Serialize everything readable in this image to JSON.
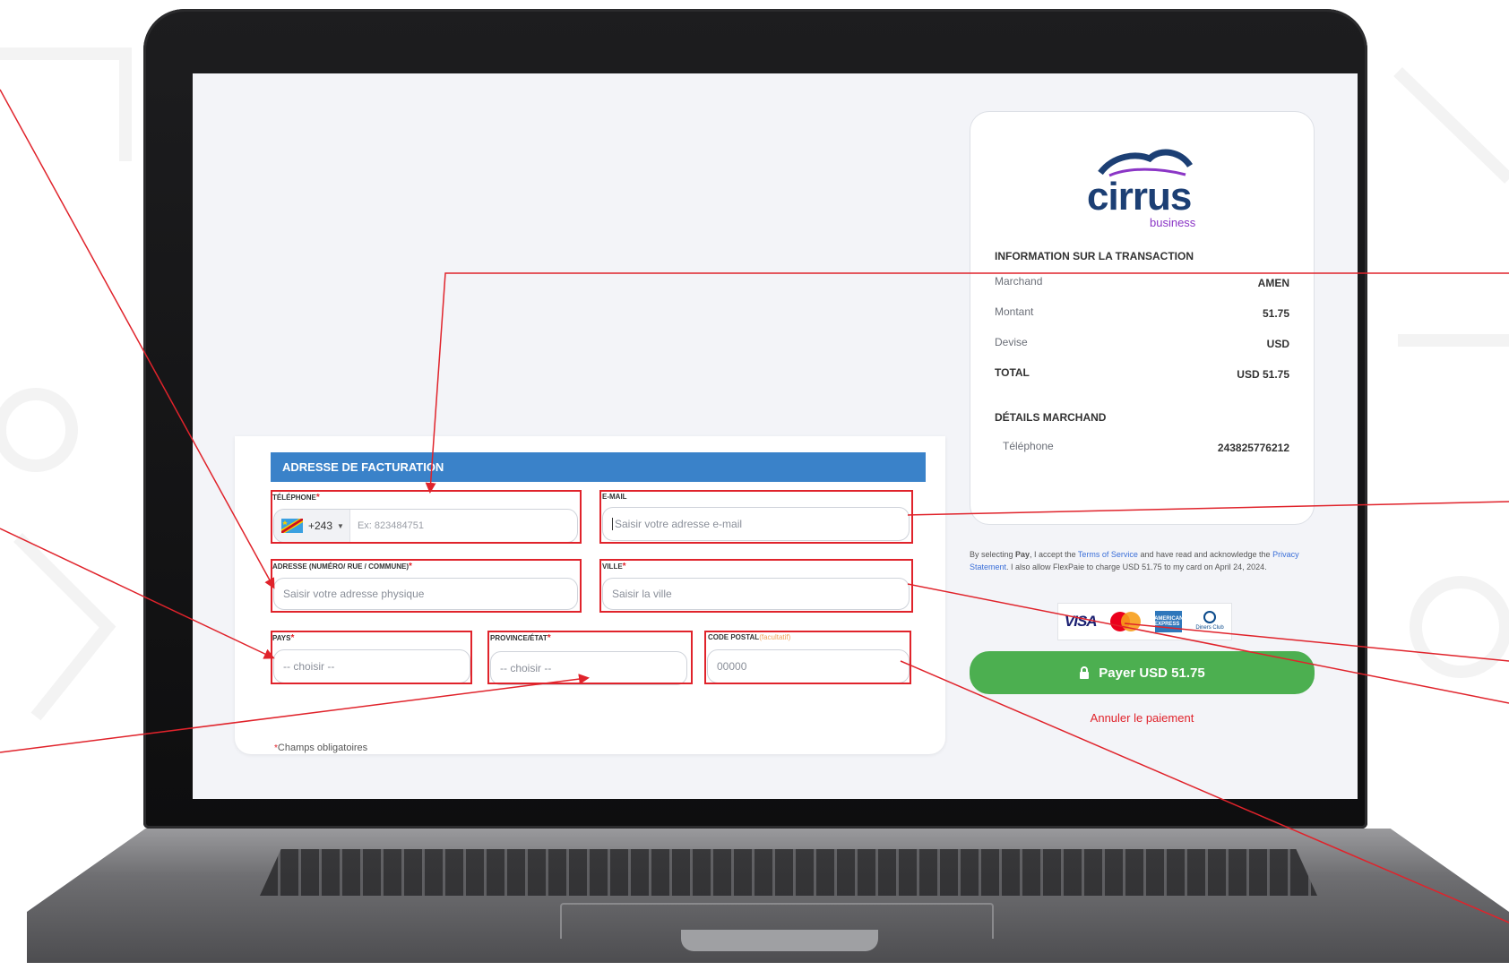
{
  "billing": {
    "header": "ADRESSE DE FACTURATION",
    "phone": {
      "label": "TÉLÉPHONE",
      "required": "*",
      "dial_code": "+243",
      "placeholder": "Ex: 823484751"
    },
    "email": {
      "label": "E-MAIL",
      "placeholder": "Saisir votre adresse e-mail"
    },
    "address": {
      "label": "ADRESSE (Numéro/ Rue / Commune)",
      "required": "*",
      "placeholder": "Saisir votre adresse physique"
    },
    "city": {
      "label": "VILLE",
      "required": "*",
      "placeholder": "Saisir la ville"
    },
    "country": {
      "label": "PAYS",
      "required": "*",
      "selected": "-- choisir --"
    },
    "province": {
      "label": "PROVINCE/ÉTAT",
      "required": "*",
      "selected": "-- choisir --"
    },
    "postal": {
      "label": "CODE POSTAL",
      "optional": "(facultatif)",
      "placeholder": "00000"
    },
    "required_note_mark": "*",
    "required_note": "Champs obligatoires"
  },
  "summary": {
    "logo_word": "cirrus",
    "logo_sub": "business",
    "info_title": "INFORMATION SUR LA TRANSACTION",
    "rows": [
      {
        "label": "Marchand",
        "value": "AMEN"
      },
      {
        "label": "Montant",
        "value": "51.75"
      },
      {
        "label": "Devise",
        "value": "USD"
      },
      {
        "label": "TOTAL",
        "value": "USD 51.75"
      }
    ],
    "merchant_title": "DÉTAILS MARCHAND",
    "merchant_phone_label": "Téléphone",
    "merchant_phone_value": "243825776212"
  },
  "terms": {
    "part1": "By selecting ",
    "pay_word": "Pay",
    "part2": ", I accept the ",
    "tos": "Terms of Service",
    "part3": " and have read and acknowledge the ",
    "privacy": "Privacy Statement",
    "part4": ". I also allow FlexPaie to charge USD 51.75 to my card on April 24, 2024."
  },
  "payment_logos": {
    "visa": "VISA",
    "mastercard_icon": "mastercard-logo",
    "amex": "AMERICAN EXPRESS",
    "diners": "Diners Club"
  },
  "pay_button": {
    "icon": "lock-icon",
    "label": "Payer USD 51.75"
  },
  "cancel_link": "Annuler le paiement",
  "colors": {
    "header_blue": "#3a82c9",
    "pay_green": "#4caf50",
    "highlight_red": "#e0232b",
    "brand_navy": "#1c3f74",
    "brand_purple": "#8b36c6"
  }
}
